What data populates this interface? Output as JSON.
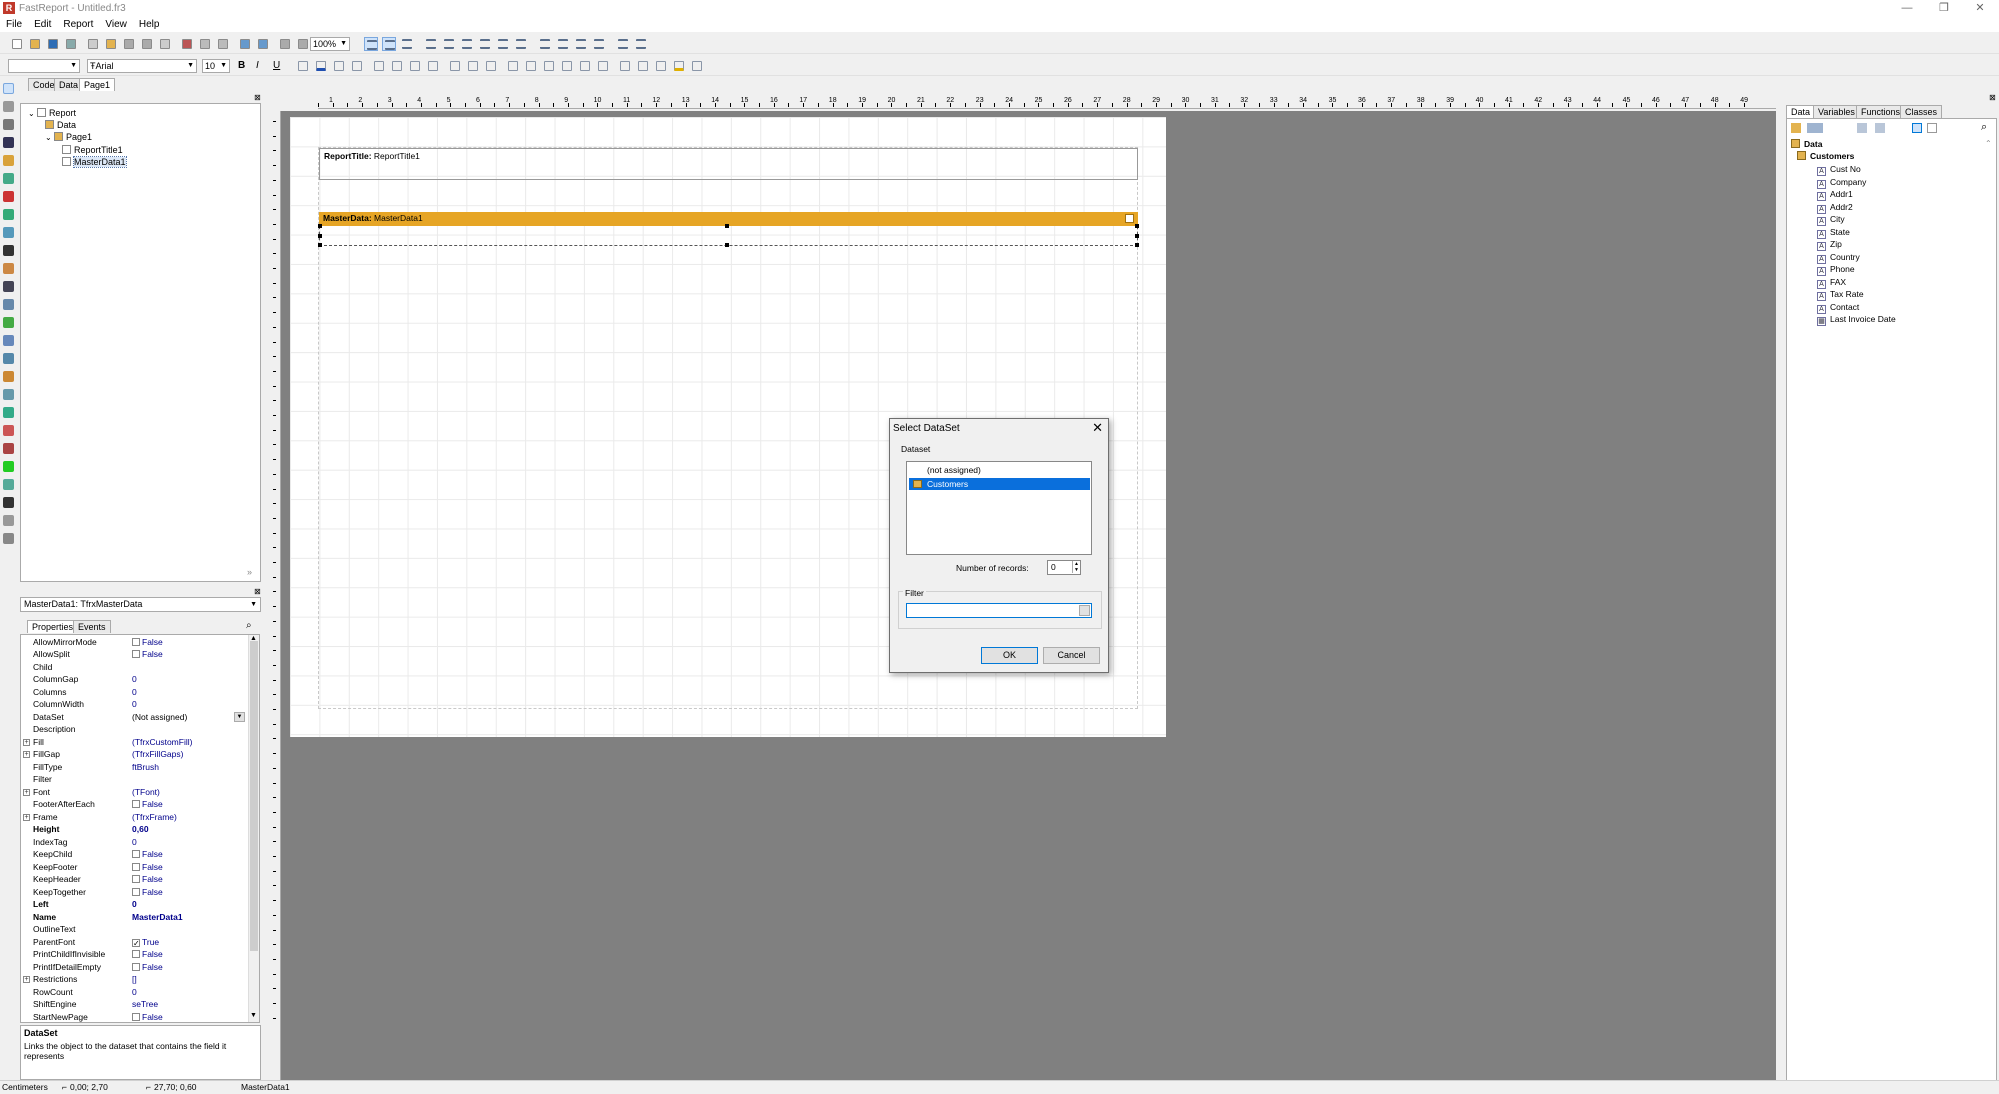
{
  "window": {
    "title": "FastReport - Untitled.fr3",
    "logo": "R"
  },
  "menu": [
    "File",
    "Edit",
    "Report",
    "View",
    "Help"
  ],
  "toolbar": {
    "zoom": "100%",
    "style_combo": "",
    "font_name": "Arial",
    "font_size": "10",
    "bold": "B",
    "italic": "I",
    "underline": "U"
  },
  "doc_tabs": [
    "Code",
    "Data",
    "Page1"
  ],
  "tree": [
    {
      "label": "Report",
      "indent": 0,
      "icon": "report-icon"
    },
    {
      "label": "Data",
      "indent": 1,
      "icon": "data-folder-icon"
    },
    {
      "label": "Page1",
      "indent": 1,
      "icon": "page-icon"
    },
    {
      "label": "ReportTitle1",
      "indent": 2,
      "icon": "band-icon"
    },
    {
      "label": "MasterData1",
      "indent": 2,
      "icon": "band-icon"
    }
  ],
  "inspector": {
    "object": "MasterData1: TfrxMasterData",
    "tabs": [
      "Properties",
      "Events"
    ],
    "props": [
      {
        "name": "AllowMirrorMode",
        "value": "False",
        "check": "off"
      },
      {
        "name": "AllowSplit",
        "value": "False",
        "check": "off"
      },
      {
        "name": "Child",
        "value": ""
      },
      {
        "name": "ColumnGap",
        "value": "0"
      },
      {
        "name": "Columns",
        "value": "0"
      },
      {
        "name": "ColumnWidth",
        "value": "0"
      },
      {
        "name": "DataSet",
        "value": "(Not assigned)",
        "dropdown": true
      },
      {
        "name": "Description",
        "value": ""
      },
      {
        "name": "Fill",
        "value": "(TfrxCustomFill)",
        "expand": true
      },
      {
        "name": "FillGap",
        "value": "(TfrxFillGaps)",
        "expand": true
      },
      {
        "name": "FillType",
        "value": "ftBrush"
      },
      {
        "name": "Filter",
        "value": ""
      },
      {
        "name": "Font",
        "value": "(TFont)",
        "expand": true
      },
      {
        "name": "FooterAfterEach",
        "value": "False",
        "check": "off"
      },
      {
        "name": "Frame",
        "value": "(TfrxFrame)",
        "expand": true
      },
      {
        "name": "Height",
        "value": "0,60",
        "bold": true
      },
      {
        "name": "IndexTag",
        "value": "0"
      },
      {
        "name": "KeepChild",
        "value": "False",
        "check": "off"
      },
      {
        "name": "KeepFooter",
        "value": "False",
        "check": "off"
      },
      {
        "name": "KeepHeader",
        "value": "False",
        "check": "off"
      },
      {
        "name": "KeepTogether",
        "value": "False",
        "check": "off"
      },
      {
        "name": "Left",
        "value": "0",
        "bold": true
      },
      {
        "name": "Name",
        "value": "MasterData1",
        "bold": true
      },
      {
        "name": "OutlineText",
        "value": ""
      },
      {
        "name": "ParentFont",
        "value": "True",
        "check": "on"
      },
      {
        "name": "PrintChildIfInvisible",
        "value": "False",
        "check": "off"
      },
      {
        "name": "PrintIfDetailEmpty",
        "value": "False",
        "check": "off"
      },
      {
        "name": "Restrictions",
        "value": "[]",
        "expand": true
      },
      {
        "name": "RowCount",
        "value": "0"
      },
      {
        "name": "ShiftEngine",
        "value": "seTree"
      },
      {
        "name": "StartNewPage",
        "value": "False",
        "check": "off"
      }
    ],
    "help_title": "DataSet",
    "help_text": "Links the object to the dataset that contains the field it represents"
  },
  "bands": {
    "report_title": {
      "kind": "ReportTitle:",
      "name": "ReportTitle1"
    },
    "master_data": {
      "kind": "MasterData:",
      "name": "MasterData1"
    }
  },
  "ruler": {
    "h": [
      "1",
      "2",
      "3",
      "4",
      "5",
      "6",
      "7",
      "8",
      "9",
      "10",
      "11",
      "12",
      "13",
      "14",
      "15",
      "16",
      "17",
      "18",
      "19",
      "20",
      "21",
      "22",
      "23",
      "24",
      "25",
      "26",
      "27",
      "28",
      "29",
      "30",
      "31",
      "32",
      "33",
      "34",
      "35",
      "36",
      "37",
      "38",
      "39",
      "40",
      "41",
      "42",
      "43",
      "44",
      "45",
      "46",
      "47",
      "48",
      "49"
    ]
  },
  "dialog": {
    "title": "Select DataSet",
    "dataset_group": "Dataset",
    "items": [
      "(not assigned)",
      "Customers"
    ],
    "selected": 1,
    "records_label": "Number of records:",
    "records_value": "0",
    "filter_group": "Filter",
    "filter_value": "",
    "ok": "OK",
    "cancel": "Cancel"
  },
  "right_panel": {
    "tabs": [
      "Data",
      "Variables",
      "Functions",
      "Classes"
    ],
    "root": "Data",
    "dataset": "Customers",
    "fields": [
      "Cust No",
      "Company",
      "Addr1",
      "Addr2",
      "City",
      "State",
      "Zip",
      "Country",
      "Phone",
      "FAX",
      "Tax Rate",
      "Contact",
      "Last Invoice Date"
    ]
  },
  "status": {
    "units": "Centimeters",
    "position": "0,00; 2,70",
    "size": "27,70; 0,60",
    "object": "MasterData1"
  }
}
